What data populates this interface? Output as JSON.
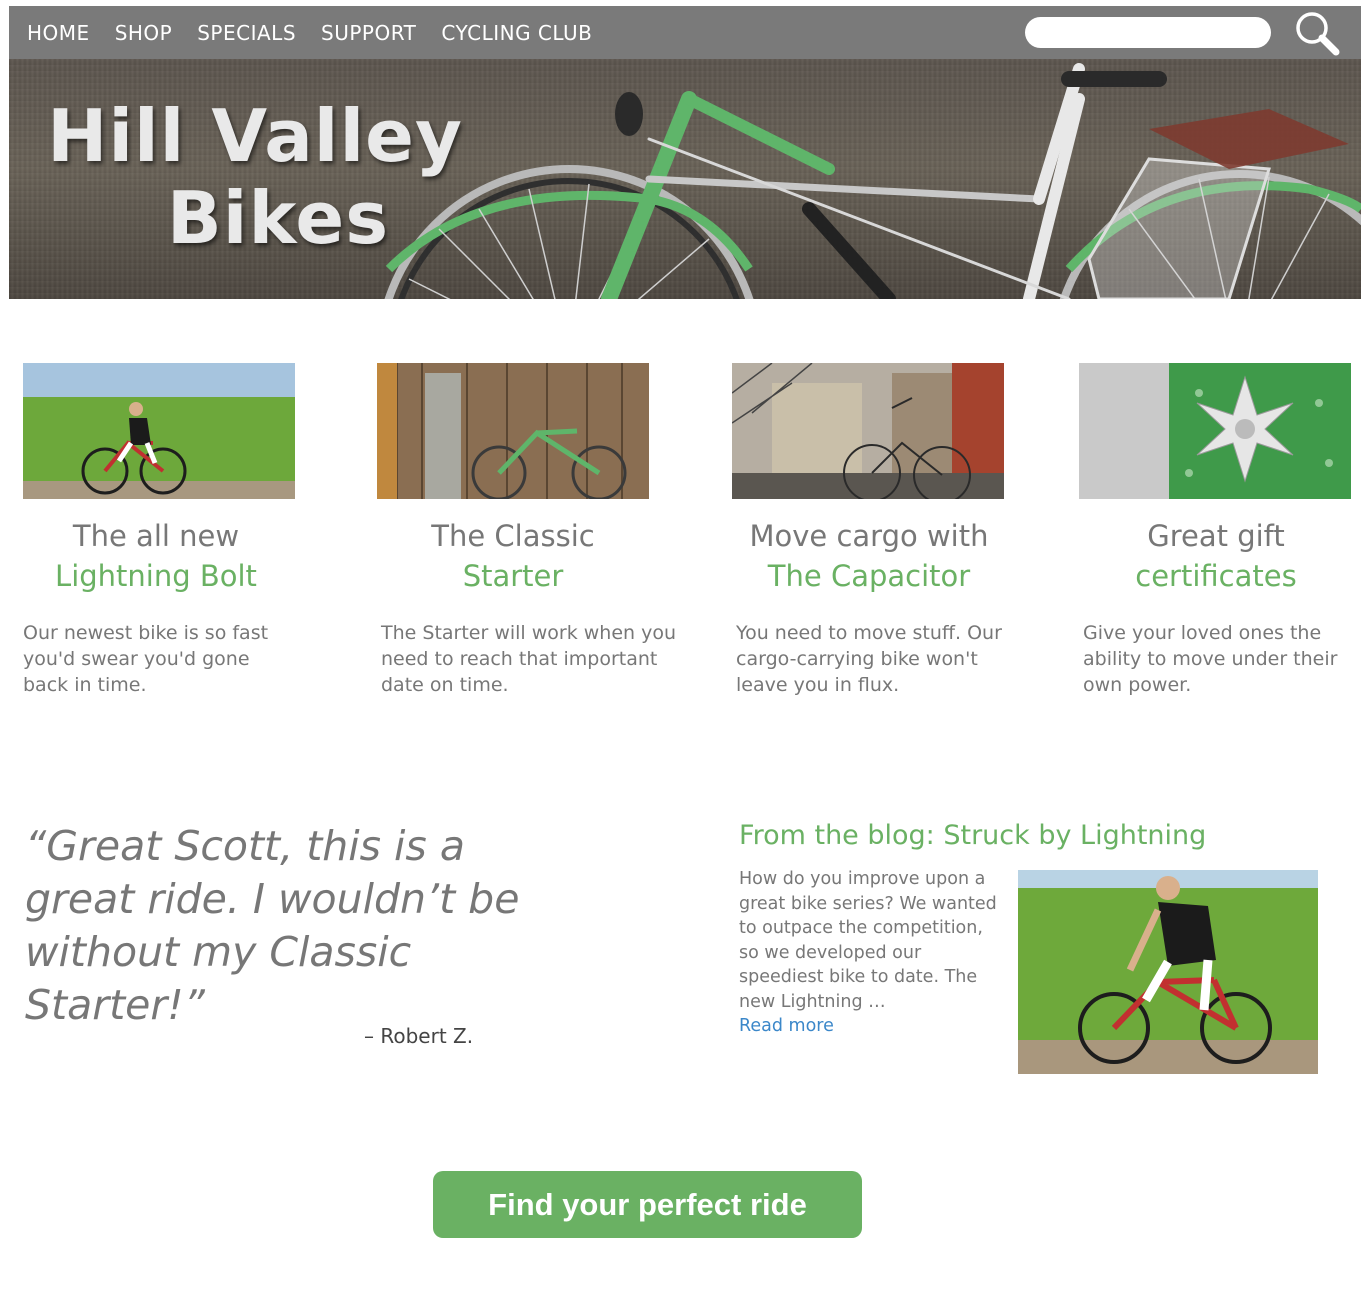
{
  "nav": {
    "links": [
      "HOME",
      "SHOP",
      "SPECIALS",
      "SUPPORT",
      "CYCLING CLUB"
    ],
    "search_placeholder": "",
    "search_icon": "search-icon"
  },
  "hero": {
    "title_line1": "Hill Valley",
    "title_line2": "Bikes"
  },
  "cards": [
    {
      "title": "The all new",
      "highlight": "Lightning Bolt",
      "text": "Our newest bike is so fast you'd swear you'd gone back in time."
    },
    {
      "title": "The Classic",
      "highlight": "Starter",
      "text": "The Starter will work when you need to reach that important date on time."
    },
    {
      "title": "Move cargo with",
      "highlight": "The Capacitor",
      "text": "You need to move stuff. Our cargo-carrying bike won't leave you in flux."
    },
    {
      "title": "Great gift",
      "highlight": "certificates",
      "text": "Give your loved ones the ability to move under their own power."
    }
  ],
  "testimonial": {
    "quote": "“Great Scott, this is a great ride. I wouldn’t be without my Classic Starter!”",
    "author": "– Robert Z."
  },
  "blog": {
    "title": "From the blog: Struck by Lightning",
    "text": "How do you improve upon a great bike series? We wanted to outpace the competition, so we developed our speediest bike to date. The new Lightning …",
    "read_more": "Read more"
  },
  "cta": {
    "label": "Find your perfect ride"
  },
  "colors": {
    "accent": "#6ab163",
    "nav_bg": "#7a7a7a",
    "link": "#3b87c9"
  }
}
